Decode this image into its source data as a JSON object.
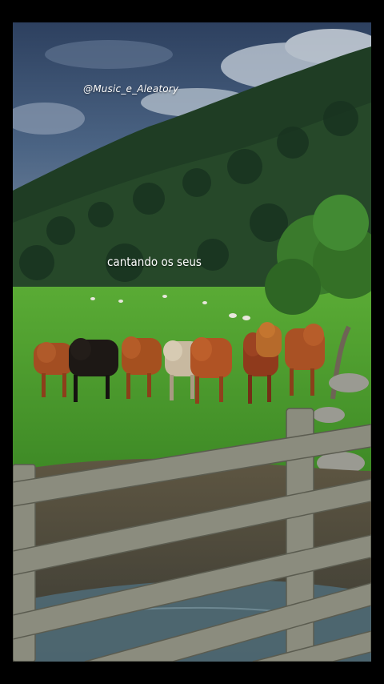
{
  "overlay": {
    "watermark": "@Music_e_Aleatory",
    "subtitle": "cantando os seus"
  },
  "scene": {
    "palette": {
      "sky": "#3c5270",
      "hill": "#1f3d24",
      "grass": "#4a9a2e",
      "fence": "#8b8c7e",
      "water": "#4f6a75",
      "cow_red": "#a34e22",
      "cow_black": "#1d1815"
    }
  }
}
